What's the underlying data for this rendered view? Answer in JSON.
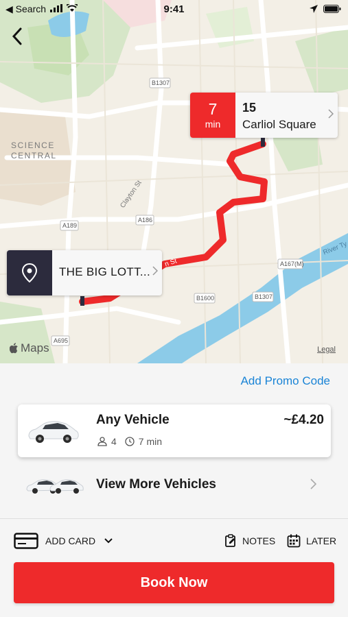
{
  "status_bar": {
    "back_app": "◀ Search",
    "time": "9:41"
  },
  "map": {
    "labels": {
      "science": "SCIENCE",
      "central": "CENTRAL",
      "clayton": "Clayton St",
      "b1307_top": "B1307",
      "a189": "A189",
      "a186": "A186",
      "a167m": "A167(M)",
      "b1600": "B1600",
      "b1307_bottom": "B1307",
      "a695": "A695",
      "river": "River Ty",
      "road_st": "n St"
    },
    "attribution": "Maps",
    "legal": "Legal"
  },
  "destination": {
    "eta_value": "7",
    "eta_unit": "min",
    "number": "15",
    "street": "Carliol Square"
  },
  "pickup": {
    "label": "THE BIG LOTT..."
  },
  "sheet": {
    "promo_link": "Add Promo Code",
    "vehicle": {
      "title": "Any Vehicle",
      "price": "~£4.20",
      "seats": "4",
      "eta": "7 min"
    },
    "more_vehicles": "View More Vehicles",
    "add_card": "ADD CARD",
    "notes": "NOTES",
    "later": "LATER",
    "book_button": "Book Now"
  },
  "colors": {
    "accent_red": "#ee2a2b",
    "link_blue": "#1a84d6",
    "pin_dark": "#2c2b3d"
  }
}
